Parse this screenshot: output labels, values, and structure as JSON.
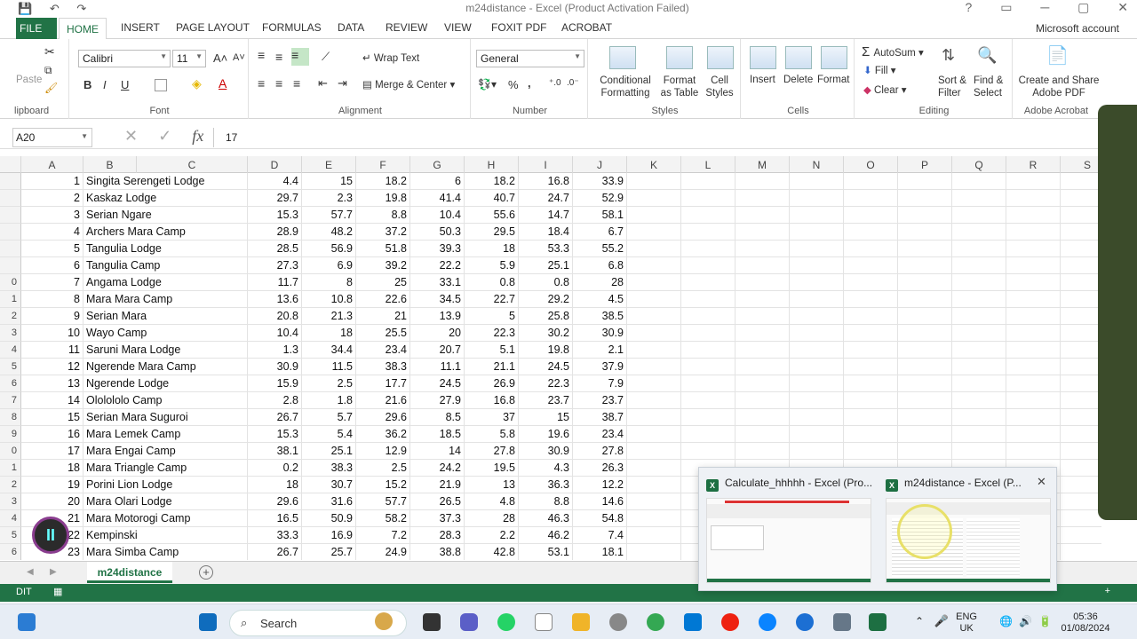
{
  "window": {
    "title": "m24distance - Excel (Product Activation Failed)",
    "controls": [
      "?",
      "▭",
      "─",
      "▢",
      "✕"
    ]
  },
  "ribbon_tabs": [
    "FILE",
    "HOME",
    "INSERT",
    "PAGE LAYOUT",
    "FORMULAS",
    "DATA",
    "REVIEW",
    "VIEW",
    "FOXIT PDF",
    "ACROBAT"
  ],
  "account": "Microsoft account",
  "ribbon": {
    "clipboard": {
      "paste": "Paste",
      "label": "lipboard"
    },
    "font": {
      "name": "Calibri",
      "size": "11",
      "label": "Font",
      "bold": "B",
      "italic": "I",
      "underline": "U"
    },
    "alignment": {
      "wrap": "Wrap Text",
      "merge": "Merge & Center",
      "label": "Alignment"
    },
    "number": {
      "format": "General",
      "percent": "%",
      "comma": ",",
      "label": "Number"
    },
    "styles": {
      "conditional": "Conditional Formatting",
      "format_table": "Format as Table",
      "cell_styles": "Cell Styles",
      "label": "Styles"
    },
    "cells": {
      "insert": "Insert",
      "delete": "Delete",
      "format": "Format",
      "label": "Cells"
    },
    "editing": {
      "autosum": "AutoSum",
      "fill": "Fill",
      "clear": "Clear",
      "sort": "Sort & Filter",
      "find": "Find & Select",
      "label": "Editing"
    },
    "acrobat": {
      "create": "Create and Share Adobe PDF",
      "label": "Adobe Acrobat"
    }
  },
  "formula_bar": {
    "name_box": "A20",
    "fx": "fx",
    "value": "17"
  },
  "columns": [
    "A",
    "B",
    "C",
    "D",
    "E",
    "F",
    "G",
    "H",
    "I",
    "J",
    "K",
    "L",
    "M",
    "N",
    "O",
    "P",
    "Q",
    "R",
    "S"
  ],
  "row_numbers": [
    "",
    "",
    "",
    "",
    "",
    "",
    "0",
    "1",
    "2",
    "3",
    "4",
    "5",
    "6",
    "7",
    "8",
    "9",
    "0",
    "1",
    "2",
    "3",
    "4",
    "5",
    "6"
  ],
  "rows": [
    [
      "1",
      "Singita Serengeti Lodge",
      "4.4",
      "15",
      "18.2",
      "6",
      "18.2",
      "16.8",
      "33.9"
    ],
    [
      "2",
      "Kaskaz Lodge",
      "29.7",
      "2.3",
      "19.8",
      "41.4",
      "40.7",
      "24.7",
      "52.9"
    ],
    [
      "3",
      "Serian Ngare",
      "15.3",
      "57.7",
      "8.8",
      "10.4",
      "55.6",
      "14.7",
      "58.1"
    ],
    [
      "4",
      "Archers Mara Camp",
      "28.9",
      "48.2",
      "37.2",
      "50.3",
      "29.5",
      "18.4",
      "6.7"
    ],
    [
      "5",
      "Tangulia Lodge",
      "28.5",
      "56.9",
      "51.8",
      "39.3",
      "18",
      "53.3",
      "55.2"
    ],
    [
      "6",
      "Tangulia Camp",
      "27.3",
      "6.9",
      "39.2",
      "22.2",
      "5.9",
      "25.1",
      "6.8"
    ],
    [
      "7",
      "Angama Lodge",
      "11.7",
      "8",
      "25",
      "33.1",
      "0.8",
      "0.8",
      "28"
    ],
    [
      "8",
      "Mara Mara Camp",
      "13.6",
      "10.8",
      "22.6",
      "34.5",
      "22.7",
      "29.2",
      "4.5"
    ],
    [
      "9",
      "Serian Mara",
      "20.8",
      "21.3",
      "21",
      "13.9",
      "5",
      "25.8",
      "38.5"
    ],
    [
      "10",
      "Wayo Camp",
      "10.4",
      "18",
      "25.5",
      "20",
      "22.3",
      "30.2",
      "30.9"
    ],
    [
      "11",
      "Saruni Mara Lodge",
      "1.3",
      "34.4",
      "23.4",
      "20.7",
      "5.1",
      "19.8",
      "2.1"
    ],
    [
      "12",
      "Ngerende Mara Camp",
      "30.9",
      "11.5",
      "38.3",
      "11.1",
      "21.1",
      "24.5",
      "37.9"
    ],
    [
      "13",
      "Ngerende Lodge",
      "15.9",
      "2.5",
      "17.7",
      "24.5",
      "26.9",
      "22.3",
      "7.9"
    ],
    [
      "14",
      "Ololololo Camp",
      "2.8",
      "1.8",
      "21.6",
      "27.9",
      "16.8",
      "23.7",
      "23.7"
    ],
    [
      "15",
      "Serian Mara Suguroi",
      "26.7",
      "5.7",
      "29.6",
      "8.5",
      "37",
      "15",
      "38.7"
    ],
    [
      "16",
      "Mara Lemek Camp",
      "15.3",
      "5.4",
      "36.2",
      "18.5",
      "5.8",
      "19.6",
      "23.4"
    ],
    [
      "17",
      "Mara Engai Camp",
      "38.1",
      "25.1",
      "12.9",
      "14",
      "27.8",
      "30.9",
      "27.8"
    ],
    [
      "18",
      "Mara Triangle Camp",
      "0.2",
      "38.3",
      "2.5",
      "24.2",
      "19.5",
      "4.3",
      "26.3"
    ],
    [
      "19",
      "Porini Lion Lodge",
      "18",
      "30.7",
      "15.2",
      "21.9",
      "13",
      "36.3",
      "12.2"
    ],
    [
      "20",
      "Mara Olari Lodge",
      "29.6",
      "31.6",
      "57.7",
      "26.5",
      "4.8",
      "8.8",
      "14.6"
    ],
    [
      "21",
      "Mara Motorogi Camp",
      "16.5",
      "50.9",
      "58.2",
      "37.3",
      "28",
      "46.3",
      "54.8"
    ],
    [
      "22",
      "Kempinski",
      "33.3",
      "16.9",
      "7.2",
      "28.3",
      "2.2",
      "46.2",
      "7.4"
    ],
    [
      "23",
      "Mara Simba Camp",
      "26.7",
      "25.7",
      "24.9",
      "38.8",
      "42.8",
      "53.1",
      "18.1"
    ]
  ],
  "sheet_tab": "m24distance",
  "status_mode": "DIT",
  "taskbar_popup": {
    "items": [
      {
        "title": "Calculate_hhhhh - Excel (Pro..."
      },
      {
        "title": "m24distance - Excel (P..."
      }
    ],
    "close": "✕"
  },
  "taskbar": {
    "search": "Search",
    "lang": "ENG",
    "region": "UK",
    "time": "05:36",
    "date": "01/08/2024"
  }
}
